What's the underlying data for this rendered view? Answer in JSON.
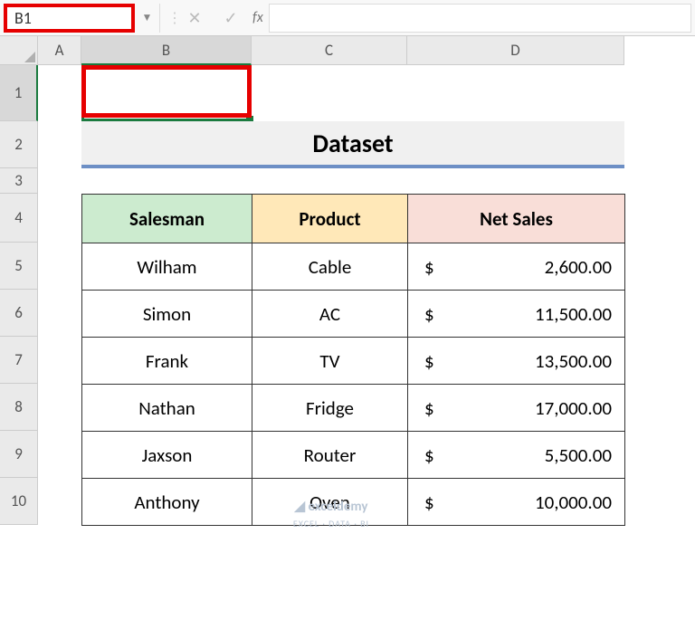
{
  "formula_bar": {
    "cell_reference": "B1",
    "fx_label": "fx",
    "formula_value": ""
  },
  "columns": [
    "A",
    "B",
    "C",
    "D"
  ],
  "rows": [
    "1",
    "2",
    "3",
    "4",
    "5",
    "6",
    "7",
    "8",
    "9",
    "10"
  ],
  "dataset_title": "Dataset",
  "table": {
    "headers": {
      "salesman": "Salesman",
      "product": "Product",
      "netsales": "Net Sales"
    },
    "rows": [
      {
        "salesman": "Wilham",
        "product": "Cable",
        "currency": "$",
        "amount": "2,600.00"
      },
      {
        "salesman": "Simon",
        "product": "AC",
        "currency": "$",
        "amount": "11,500.00"
      },
      {
        "salesman": "Frank",
        "product": "TV",
        "currency": "$",
        "amount": "13,500.00"
      },
      {
        "salesman": "Nathan",
        "product": "Fridge",
        "currency": "$",
        "amount": "17,000.00"
      },
      {
        "salesman": "Jaxson",
        "product": "Router",
        "currency": "$",
        "amount": "5,500.00"
      },
      {
        "salesman": "Anthony",
        "product": "Oven",
        "currency": "$",
        "amount": "10,000.00"
      }
    ]
  },
  "watermark": {
    "brand": "exceldemy",
    "tagline": "EXCEL · DATA · BI"
  }
}
